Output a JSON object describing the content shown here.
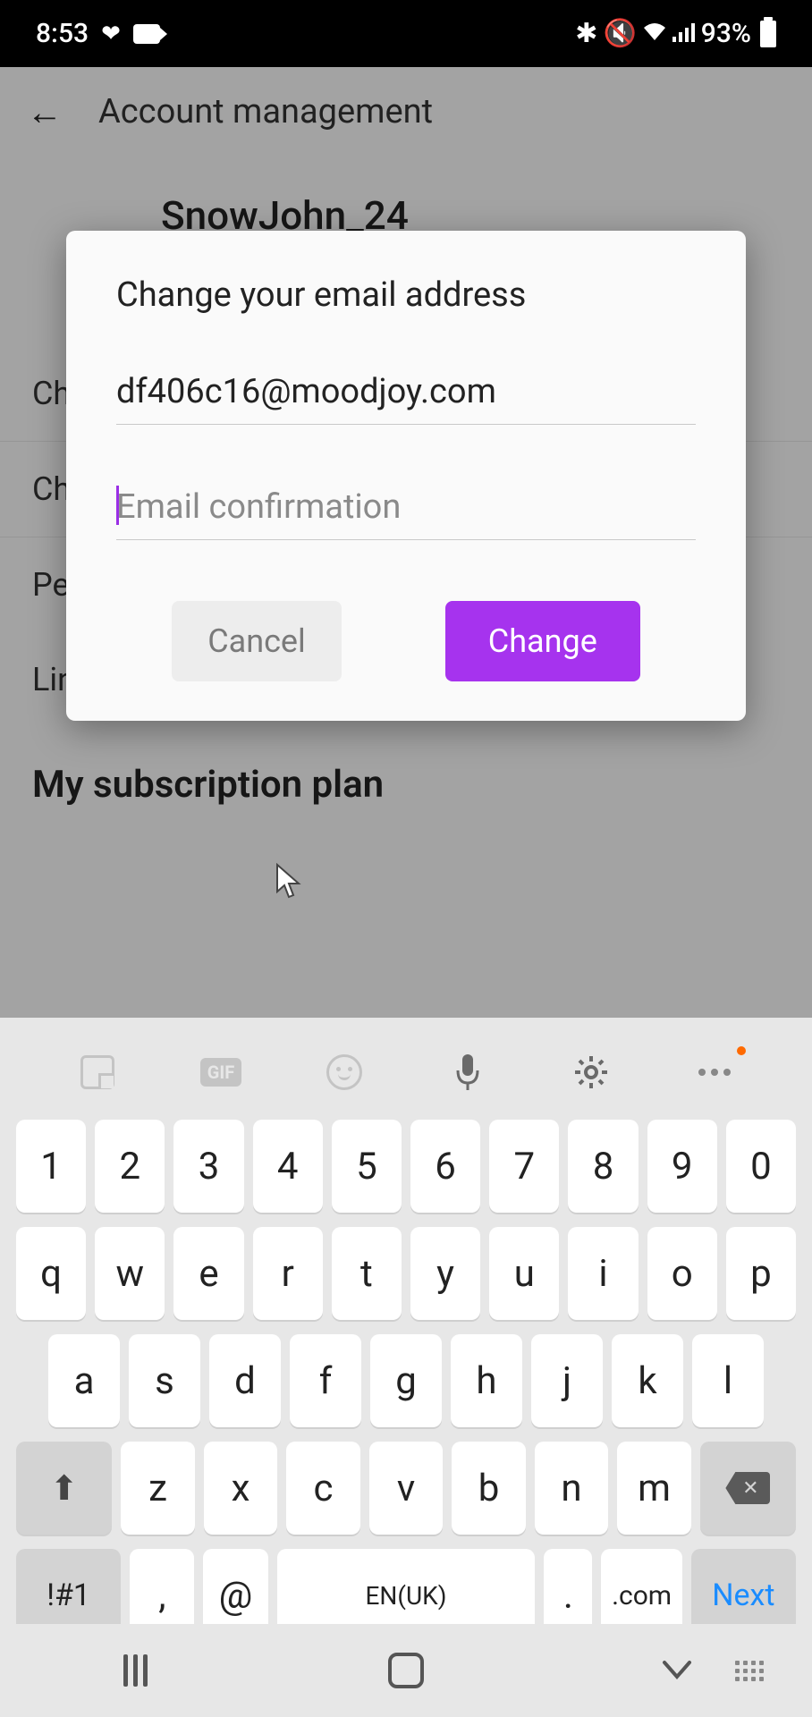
{
  "status_bar": {
    "time": "8:53",
    "battery_pct": "93%"
  },
  "app": {
    "title": "Account management",
    "username": "SnowJohn_24",
    "bg_items": {
      "item1": "Ch",
      "item2": "Ch",
      "item3": "Pe",
      "linked": "Linked accounts",
      "section": "My subscription plan"
    }
  },
  "modal": {
    "title": "Change your email address",
    "email_value": "df406c16@moodjoy.com",
    "confirm_placeholder": "Email confirmation",
    "cancel_label": "Cancel",
    "change_label": "Change"
  },
  "keyboard": {
    "row1": [
      "1",
      "2",
      "3",
      "4",
      "5",
      "6",
      "7",
      "8",
      "9",
      "0"
    ],
    "row2": [
      "q",
      "w",
      "e",
      "r",
      "t",
      "y",
      "u",
      "i",
      "o",
      "p"
    ],
    "row3": [
      "a",
      "s",
      "d",
      "f",
      "g",
      "h",
      "j",
      "k",
      "l"
    ],
    "row4": [
      "z",
      "x",
      "c",
      "v",
      "b",
      "n",
      "m"
    ],
    "sym_label": "!#1",
    "comma": ",",
    "at": "@",
    "space_label": "EN(UK)",
    "period": ".",
    "dotcom": ".com",
    "next_label": "Next"
  }
}
